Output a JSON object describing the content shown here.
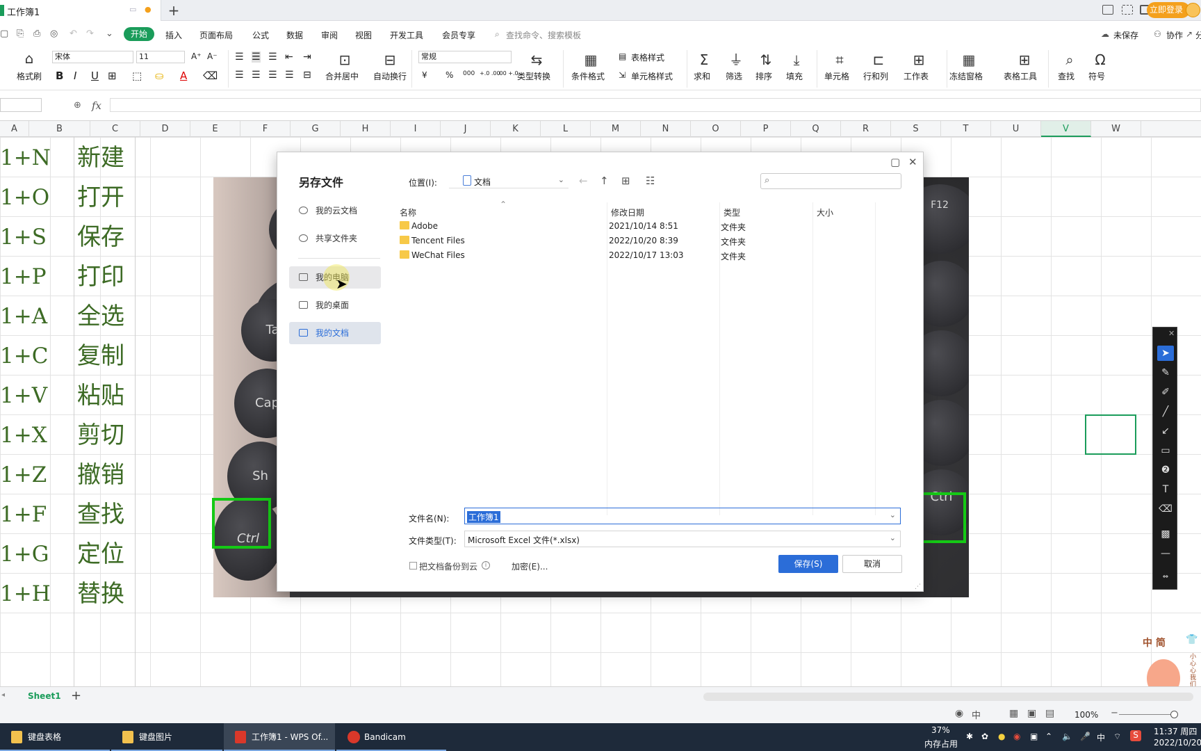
{
  "titlebar": {
    "doc_tab": "工作簿1",
    "login_button": "立即登录"
  },
  "menu": {
    "items": [
      "开始",
      "插入",
      "页面布局",
      "公式",
      "数据",
      "审阅",
      "视图",
      "开发工具",
      "会员专享"
    ],
    "search": "查找命令、搜索模板",
    "unsaved": "未保存",
    "collab": "协作",
    "share": "分"
  },
  "ribbon": {
    "format_painter": "格式刷",
    "font_name": "宋体",
    "font_size": "11",
    "merge_center": "合并居中",
    "wrap_text": "自动换行",
    "number_format": "常规",
    "type_convert": "类型转换",
    "conditional_format": "条件格式",
    "table_style": "表格样式",
    "cell_style": "单元格样式",
    "sum": "求和",
    "filter": "筛选",
    "sort": "排序",
    "fill": "填充",
    "cell": "单元格",
    "row_col": "行和列",
    "worksheet": "工作表",
    "freeze": "冻结窗格",
    "table_tools": "表格工具",
    "find": "查找",
    "symbol": "符号",
    "bold": "B",
    "italic": "I",
    "underline": "U",
    "font_color": "A",
    "percent": "%",
    "thousands": "000",
    "currency": "¥",
    "inc_decimal": "+.0 .00",
    "dec_decimal": ".00 +.0"
  },
  "formula_bar": {
    "fx": "fx"
  },
  "columns": [
    "A",
    "B",
    "C",
    "D",
    "E",
    "F",
    "G",
    "H",
    "I",
    "J",
    "K",
    "L",
    "M",
    "N",
    "O",
    "P",
    "Q",
    "R",
    "S",
    "T",
    "U",
    "V",
    "W"
  ],
  "selected_column": "V",
  "rows": [
    {
      "a": "1+N",
      "b": "新建"
    },
    {
      "a": "1+O",
      "b": "打开"
    },
    {
      "a": "1+S",
      "b": "保存"
    },
    {
      "a": "1+P",
      "b": "打印"
    },
    {
      "a": "1+A",
      "b": "全选"
    },
    {
      "a": "1+C",
      "b": "复制"
    },
    {
      "a": "1+V",
      "b": "粘贴"
    },
    {
      "a": "1+X",
      "b": "剪切"
    },
    {
      "a": "1+Z",
      "b": "撤销"
    },
    {
      "a": "1+F",
      "b": "查找"
    },
    {
      "a": "1+G",
      "b": "定位"
    },
    {
      "a": "1+H",
      "b": "替换"
    }
  ],
  "photo_keys": [
    "Ctrl",
    "Ta",
    "Cap",
    "Sh",
    "F12",
    "Ctrl"
  ],
  "dialog": {
    "title": "另存文件",
    "location_label": "位置(I):",
    "location_value": "文档",
    "sidebar": [
      "我的云文档",
      "共享文件夹",
      "我的电脑",
      "我的桌面",
      "我的文档"
    ],
    "columns": [
      "名称",
      "修改日期",
      "类型",
      "大小"
    ],
    "files": [
      {
        "name": "Adobe",
        "date": "2021/10/14 8:51",
        "type": "文件夹"
      },
      {
        "name": "Tencent Files",
        "date": "2022/10/20 8:39",
        "type": "文件夹"
      },
      {
        "name": "WeChat Files",
        "date": "2022/10/17 13:03",
        "type": "文件夹"
      }
    ],
    "filename_label": "文件名(N):",
    "filename_value": "工作簿1",
    "filetype_label": "文件类型(T):",
    "filetype_value": "Microsoft Excel 文件(*.xlsx)",
    "backup_label": "把文档备份到云",
    "encrypt_label": "加密(E)...",
    "save_button": "保存(S)",
    "cancel_button": "取消"
  },
  "sheet": {
    "tab": "Sheet1"
  },
  "status": {
    "zoom": "100%"
  },
  "mascot": {
    "title": "中 简",
    "note": "小心心我们走!!!"
  },
  "taskbar": {
    "tasks": [
      "键盘表格",
      "键盘图片",
      "工作簿1 - WPS Of...",
      "Bandicam"
    ],
    "memory_percent": "37%",
    "memory_label": "内存占用",
    "ime": "中",
    "time": "11:37 周四",
    "date": "2022/10/20"
  }
}
